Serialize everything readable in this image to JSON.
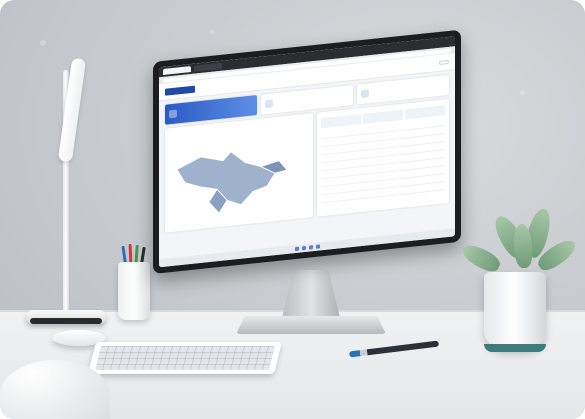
{
  "scene": {
    "description_colors": {
      "wall": "#c9ccd0",
      "desk": "#eceef0",
      "accent_blue": "#2a5bc4",
      "pot_band": "#3d7a7c"
    }
  },
  "screen": {
    "app_header": {
      "logo_text": "",
      "button_label": ""
    },
    "cards": [
      {
        "title": "",
        "value": ""
      },
      {
        "title": "",
        "value": ""
      },
      {
        "title": "",
        "value": ""
      }
    ],
    "map_panel": {
      "title": ""
    },
    "list_panel": {
      "title": ""
    }
  }
}
